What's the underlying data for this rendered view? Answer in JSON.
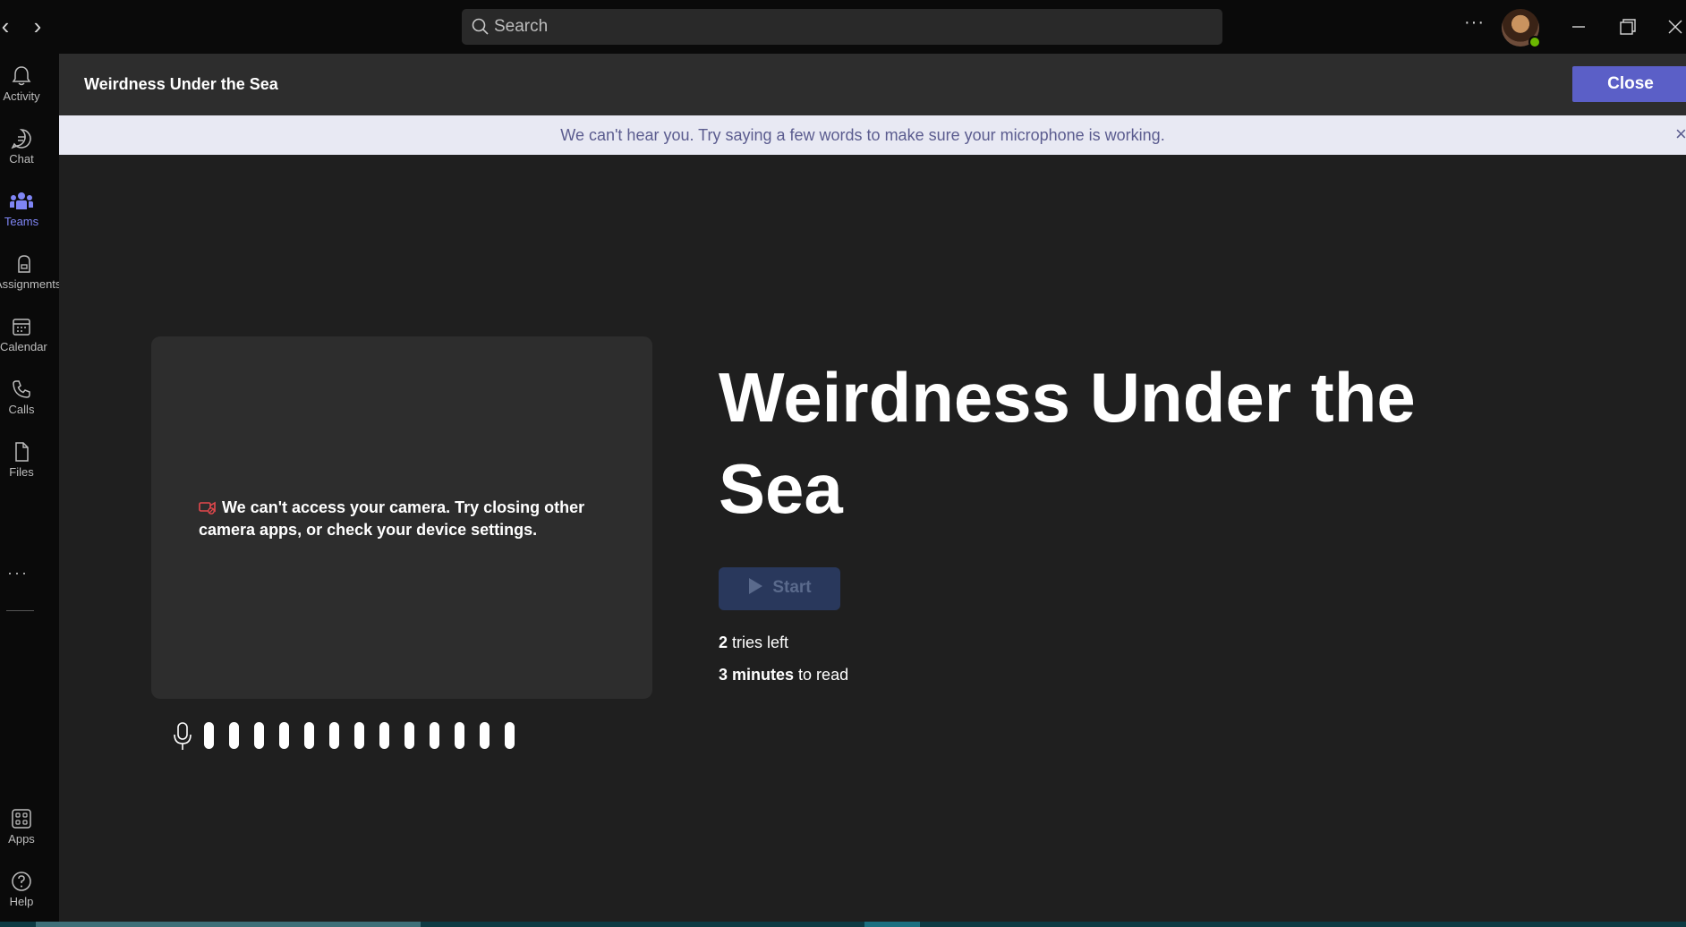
{
  "titlebar": {
    "back_glyph": "‹",
    "forward_glyph": "›",
    "search_placeholder": "Search",
    "more_glyph": "···",
    "icons": [
      "chevron-left-icon",
      "chevron-right-icon",
      "search-icon",
      "more-icon",
      "minimize-icon",
      "restore-icon",
      "close-icon"
    ]
  },
  "rail": {
    "items": [
      {
        "label": "Activity",
        "icon": "bell-icon"
      },
      {
        "label": "Chat",
        "icon": "chat-icon"
      },
      {
        "label": "Teams",
        "icon": "teams-icon",
        "active": true
      },
      {
        "label": "Assignments",
        "icon": "backpack-icon"
      },
      {
        "label": "Calendar",
        "icon": "calendar-icon"
      },
      {
        "label": "Calls",
        "icon": "phone-icon"
      },
      {
        "label": "Files",
        "icon": "file-icon"
      }
    ],
    "more_glyph": "···",
    "bottom_items": [
      {
        "label": "Apps",
        "icon": "apps-icon"
      },
      {
        "label": "Help",
        "icon": "help-icon"
      }
    ],
    "active_color": "#7f85f5"
  },
  "header": {
    "title": "Weirdness Under the Sea",
    "close_label": "Close",
    "close_color": "#5b5fc7"
  },
  "banner": {
    "text": "We can't hear you. Try saying a few words to make sure your microphone is working.",
    "close_glyph": "×"
  },
  "camera": {
    "message": "We can't access your camera. Try closing other camera apps, or check your device settings.",
    "icon": "camera-off-icon"
  },
  "mic": {
    "icon": "microphone-icon",
    "bar_count": 13
  },
  "reading": {
    "title": "Weirdness Under the Sea",
    "start_label": "Start",
    "tries_count": "2",
    "tries_suffix": "tries left",
    "minutes_count": "3 minutes",
    "minutes_suffix": "to read"
  }
}
